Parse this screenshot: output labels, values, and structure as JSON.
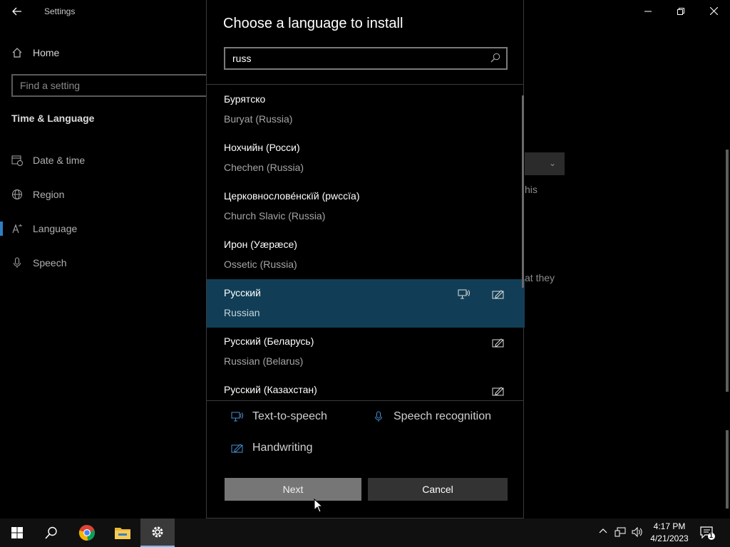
{
  "settings_window": {
    "app_title": "Settings",
    "nav_home": "Home",
    "search_placeholder": "Find a setting",
    "section_title": "Time & Language",
    "nav_items": [
      {
        "label": "Date & time",
        "icon": "calendar-clock-icon"
      },
      {
        "label": "Region",
        "icon": "globe-icon"
      },
      {
        "label": "Language",
        "icon": "language-icon"
      },
      {
        "label": "Speech",
        "icon": "microphone-icon"
      }
    ],
    "background_fragments": [
      "his",
      "at they"
    ]
  },
  "dialog": {
    "title": "Choose a language to install",
    "search_value": "russ",
    "languages": [
      {
        "native": "Бурятско",
        "english": "Buryat (Russia)",
        "features": []
      },
      {
        "native": "Нохчийн (Росси)",
        "english": "Chechen (Russia)",
        "features": []
      },
      {
        "native": "Церковнослове́нскїй (рwссїа)",
        "english": "Church Slavic (Russia)",
        "features": []
      },
      {
        "native": "Ирон (Уæрæсе)",
        "english": "Ossetic (Russia)",
        "features": []
      },
      {
        "native": "Русский",
        "english": "Russian",
        "features": [
          "text-to-speech",
          "handwriting"
        ],
        "selected": true
      },
      {
        "native": "Русский (Беларусь)",
        "english": "Russian (Belarus)",
        "features": [
          "handwriting"
        ]
      },
      {
        "native": "Русский (Казахстан)",
        "english": "",
        "features": [
          "handwriting"
        ]
      }
    ],
    "legend": {
      "tts": "Text-to-speech",
      "speech_recognition": "Speech recognition",
      "handwriting": "Handwriting"
    },
    "buttons": {
      "next": "Next",
      "cancel": "Cancel"
    }
  },
  "taskbar": {
    "time": "4:17 PM",
    "date": "4/21/2023",
    "notification_count": "1"
  },
  "colors": {
    "selected_row": "#113e56",
    "accent": "#4a8fd0"
  }
}
